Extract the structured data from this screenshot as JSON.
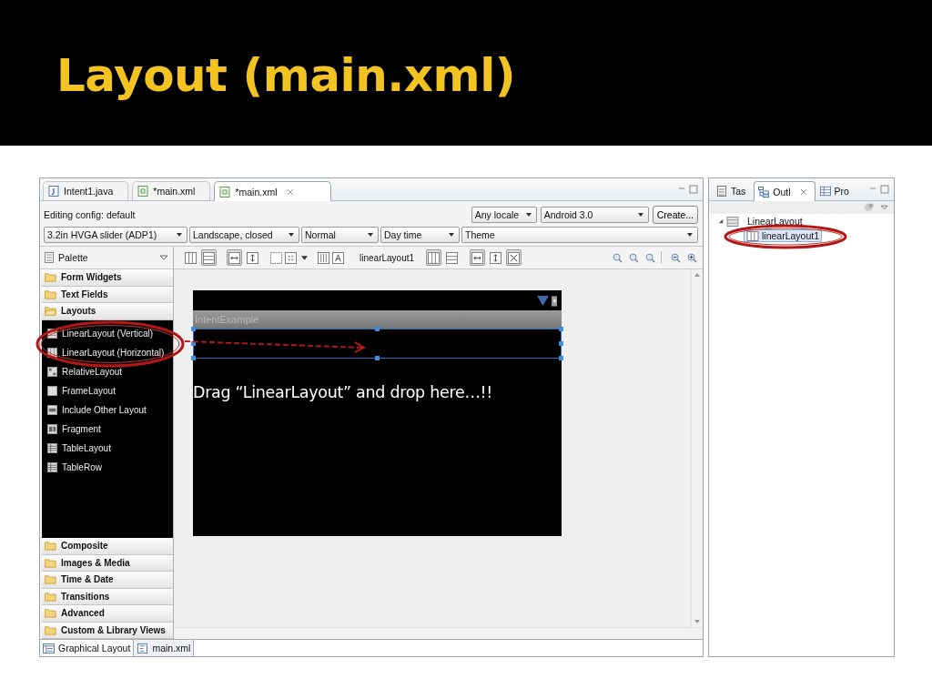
{
  "slide_title": "Layout (main.xml)",
  "editor": {
    "tabs": [
      {
        "label": "Intent1.java",
        "kind": "java",
        "selected": false
      },
      {
        "label": "*main.xml",
        "kind": "xml",
        "selected": false
      },
      {
        "label": "*main.xml",
        "kind": "xml",
        "selected": true
      }
    ],
    "config_label": "Editing config: default",
    "locale": "Any locale",
    "target": "Android 3.0",
    "create_button": "Create...",
    "config_dropdowns": [
      "3.2in HVGA slider (ADP1)",
      "Landscape, closed",
      "Normal",
      "Day time",
      "Theme"
    ],
    "palette": {
      "title": "Palette",
      "categories": [
        {
          "label": "Form Widgets",
          "expanded": false
        },
        {
          "label": "Text Fields",
          "expanded": false
        },
        {
          "label": "Layouts",
          "expanded": true,
          "items": [
            {
              "label": "LinearLayout (Vertical)",
              "kind": "rows"
            },
            {
              "label": "LinearLayout (Horizontal)",
              "kind": "columns"
            },
            {
              "label": "RelativeLayout",
              "kind": "relative"
            },
            {
              "label": "FrameLayout",
              "kind": "frame"
            },
            {
              "label": "Include Other Layout",
              "kind": "include"
            },
            {
              "label": "Fragment",
              "kind": "fragment"
            },
            {
              "label": "TableLayout",
              "kind": "table"
            },
            {
              "label": "TableRow",
              "kind": "table"
            }
          ]
        },
        {
          "label": "Composite",
          "expanded": false
        },
        {
          "label": "Images & Media",
          "expanded": false
        },
        {
          "label": "Time & Date",
          "expanded": false
        },
        {
          "label": "Transitions",
          "expanded": false
        },
        {
          "label": "Advanced",
          "expanded": false
        },
        {
          "label": "Custom & Library Views",
          "expanded": false
        }
      ]
    },
    "toolbar": {
      "left_toggles": [
        {
          "kind": "columns",
          "selected": false
        },
        {
          "kind": "rows",
          "selected": true
        },
        {
          "kind": "fill-width",
          "selected": true
        },
        {
          "kind": "fill-height",
          "selected": false
        }
      ],
      "selection": "linearLayout1",
      "right_toggles": [
        {
          "kind": "columns",
          "selected": true
        },
        {
          "kind": "rows",
          "selected": false
        },
        {
          "kind": "fill-width",
          "selected": true
        },
        {
          "kind": "fill-height",
          "selected": false
        },
        {
          "kind": "fill-both",
          "selected": true
        }
      ]
    },
    "canvas": {
      "app_title": "IntentExample",
      "hint": "Drag “LinearLayout” and drop here…!!"
    },
    "bottom_tabs": [
      {
        "label": "Graphical Layout",
        "kind": "design",
        "selected": true
      },
      {
        "label": "main.xml",
        "kind": "source",
        "selected": false
      }
    ]
  },
  "outline_panel": {
    "tabs": [
      {
        "label": "Tas",
        "kind": "tasks",
        "selected": false
      },
      {
        "label": "Outl",
        "kind": "outline",
        "selected": true
      },
      {
        "label": "Pro",
        "kind": "properties",
        "selected": false
      }
    ],
    "tree": [
      {
        "label": "LinearLayout",
        "expanded": true,
        "selected": false,
        "children": [
          {
            "label": "linearLayout1",
            "selected": true
          }
        ]
      }
    ]
  }
}
